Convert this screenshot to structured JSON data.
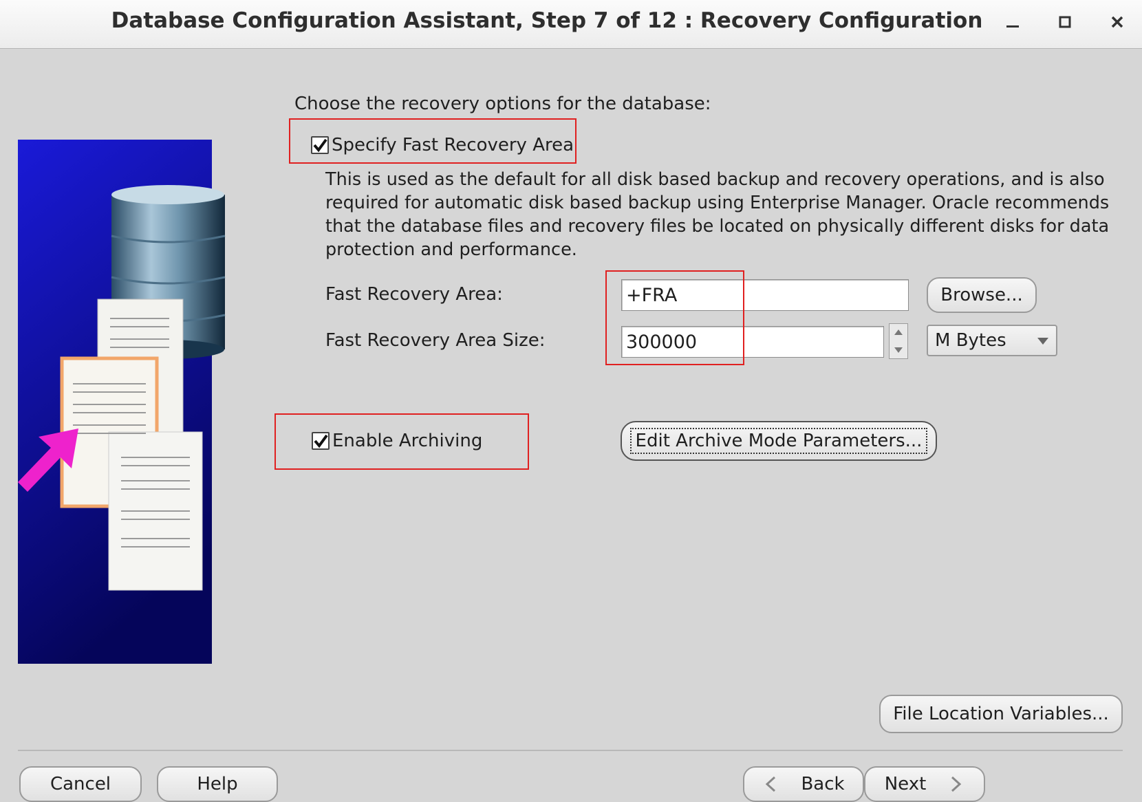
{
  "window": {
    "title": "Database Configuration Assistant, Step 7 of 12 : Recovery Configuration",
    "minimize_glyph": "–",
    "maximize_glyph": "◻",
    "close_glyph": "✕"
  },
  "intro_text": "Choose the recovery options for the database:",
  "fra": {
    "checkbox_label": "Specify Fast Recovery Area",
    "checked": true,
    "description": "This is used as the default for all disk based backup and recovery operations, and is also required for automatic disk based backup using Enterprise Manager. Oracle recommends that the database files and recovery files be located on physically different disks for data protection and performance.",
    "area_label": "Fast Recovery Area:",
    "area_value": "+FRA",
    "browse_label": "Browse...",
    "size_label": "Fast Recovery Area Size:",
    "size_value": "300000",
    "unit_selected": "M Bytes"
  },
  "archiving": {
    "checkbox_label": "Enable Archiving",
    "checked": true,
    "edit_params_label": "Edit Archive Mode Parameters..."
  },
  "file_location_label": "File Location Variables...",
  "footer": {
    "cancel": "Cancel",
    "help": "Help",
    "back": "Back",
    "next": "Next"
  },
  "colors": {
    "highlight_box": "#e02020",
    "panel_blue_top": "#1a1ad8",
    "panel_blue_bottom": "#05055a",
    "arrow_magenta": "#ee22cc"
  }
}
